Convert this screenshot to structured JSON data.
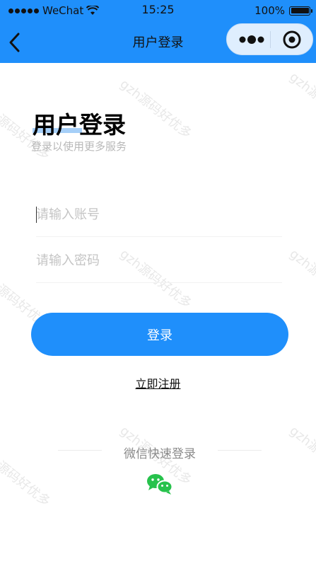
{
  "status_bar": {
    "carrier": "WeChat",
    "time": "15:25",
    "battery": "100%",
    "battery_level": 1.0
  },
  "nav": {
    "title": "用户登录",
    "back_icon": "chevron-left-icon",
    "more_icon": "more-dots-icon",
    "close_icon": "target-circle-icon"
  },
  "watermark": "gzh源码好优多",
  "header": {
    "title": "用户登录",
    "subtitle": "登录以使用更多服务"
  },
  "form": {
    "account_placeholder": "请输入账号",
    "password_placeholder": "请输入密码",
    "login_label": "登录",
    "register_label": "立即注册"
  },
  "quick_login": {
    "label": "微信快速登录",
    "icon": "wechat-icon"
  },
  "colors": {
    "primary": "#1f8ffb",
    "accent_underline": "#9ccaf7",
    "wechat_green": "#27c24c"
  }
}
